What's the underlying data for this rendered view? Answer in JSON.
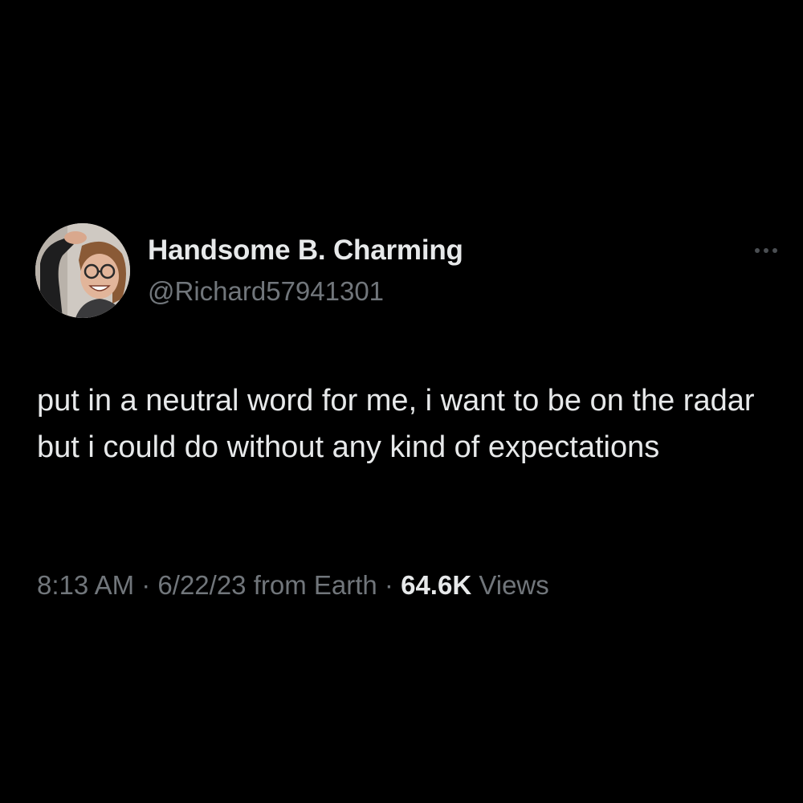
{
  "tweet": {
    "author": {
      "display_name": "Handsome B. Charming",
      "handle": "@Richard57941301"
    },
    "text": "put in a neutral word for me, i want to be on the radar but i could do without any kind of expectations",
    "meta": {
      "time": "8:13 AM",
      "separator": "·",
      "date": "6/22/23",
      "source": "from Earth",
      "views_count": "64.6K",
      "views_label": "Views"
    }
  },
  "icons": {
    "more": "more-horizontal-icon",
    "avatar": "profile-photo"
  },
  "colors": {
    "background": "#000000",
    "primary_text": "#e7e9ea",
    "secondary_text": "#71767b"
  }
}
